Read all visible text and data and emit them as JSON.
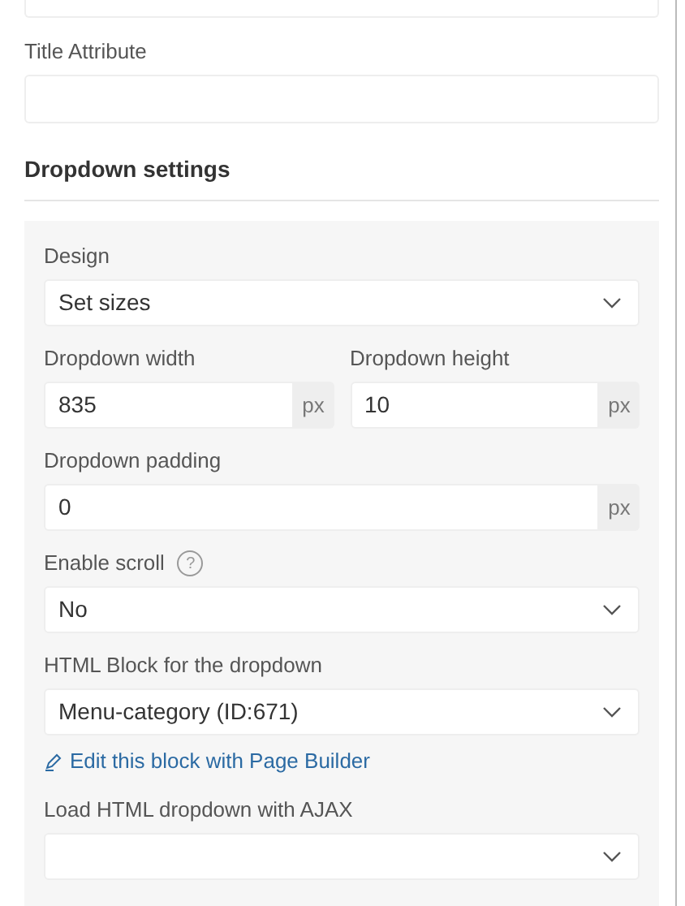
{
  "top_field": {
    "kind": "text"
  },
  "title_attribute": {
    "label": "Title Attribute"
  },
  "section": {
    "title": "Dropdown settings"
  },
  "rows": [
    {
      "fields": [
        {
          "kind": "select",
          "label": "Design",
          "value": "Set sizes"
        }
      ]
    },
    {
      "fields": [
        {
          "kind": "unit",
          "label": "Dropdown width",
          "value": "835",
          "unit": "px"
        },
        {
          "kind": "unit",
          "label": "Dropdown height",
          "value": "10",
          "unit": "px"
        }
      ]
    },
    {
      "fields": [
        {
          "kind": "unit",
          "label": "Dropdown padding",
          "value": "0",
          "unit": "px"
        }
      ]
    },
    {
      "fields": [
        {
          "kind": "select",
          "label": "Enable scroll",
          "help": "?",
          "value": "No"
        }
      ]
    },
    {
      "fields": [
        {
          "kind": "select",
          "label": "HTML Block for the dropdown",
          "value": "Menu-category (ID:671)",
          "link": "Edit this block with Page Builder"
        }
      ]
    },
    {
      "fields": [
        {
          "kind": "select",
          "label": "Load HTML dropdown with AJAX"
        }
      ]
    }
  ]
}
